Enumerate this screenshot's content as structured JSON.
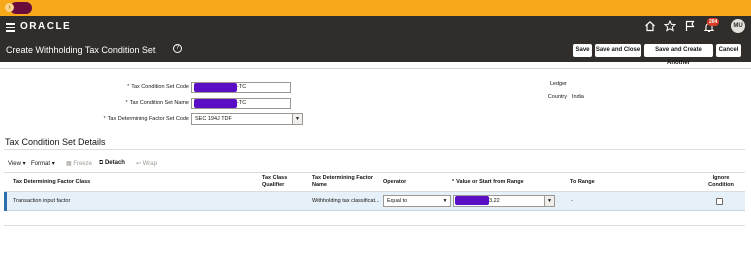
{
  "env_bar": {
    "expand_glyph": "›"
  },
  "header": {
    "brand": "ORACLE",
    "icons": [
      "home-icon",
      "star-icon",
      "flag-icon",
      "bell-icon"
    ],
    "notification_count": "204",
    "avatar_initials": "MU"
  },
  "page": {
    "title": "Create Withholding Tax Condition Set",
    "help_glyph": "?",
    "buttons": {
      "save": "Save",
      "save_close": "Save and Close",
      "save_create_another": "Save and Create Another",
      "cancel": "Cancel"
    }
  },
  "form": {
    "set_code": {
      "label": "Tax Condition Set Code",
      "required": "*",
      "value_suffix": "-TC"
    },
    "set_name": {
      "label": "Tax Condition Set Name",
      "required": "*",
      "value_suffix": "-TC"
    },
    "factor_set_code": {
      "label": "Tax Determining Factor Set Code",
      "required": "*",
      "value": "SEC 194J TDF"
    },
    "ledger": {
      "label": "Ledger",
      "value": ""
    },
    "country": {
      "label": "Country",
      "value": "India"
    }
  },
  "details": {
    "title": "Tax Condition Set Details",
    "toolbar": {
      "view": "View",
      "format": "Format",
      "freeze": "Freeze",
      "detach": "Detach",
      "wrap": "Wrap"
    },
    "columns": {
      "factor_class": "Tax Determining Factor Class",
      "class_qualifier": [
        "Tax Class",
        "Qualifier"
      ],
      "factor_name": [
        "Tax Determining Factor",
        "Name"
      ],
      "operator": "Operator",
      "value_from": "Value or Start from Range",
      "value_from_required": "*",
      "to_range": "To Range",
      "ignore_condition": [
        "Ignore",
        "Condition"
      ]
    },
    "rows": [
      {
        "factor_class": "Transaction input factor",
        "class_qualifier": "",
        "factor_name": "Withholding tax classificat...",
        "operator": "Equal to",
        "value_suffix": "3.22",
        "to_range": "-",
        "ignore_condition": false
      }
    ]
  },
  "colors": {
    "env_bar": "#f7a81b",
    "header_bg": "#312d2a",
    "redaction": "#5b0fc4",
    "selected_row": "#e6f0f8",
    "badge": "#d63b25"
  }
}
